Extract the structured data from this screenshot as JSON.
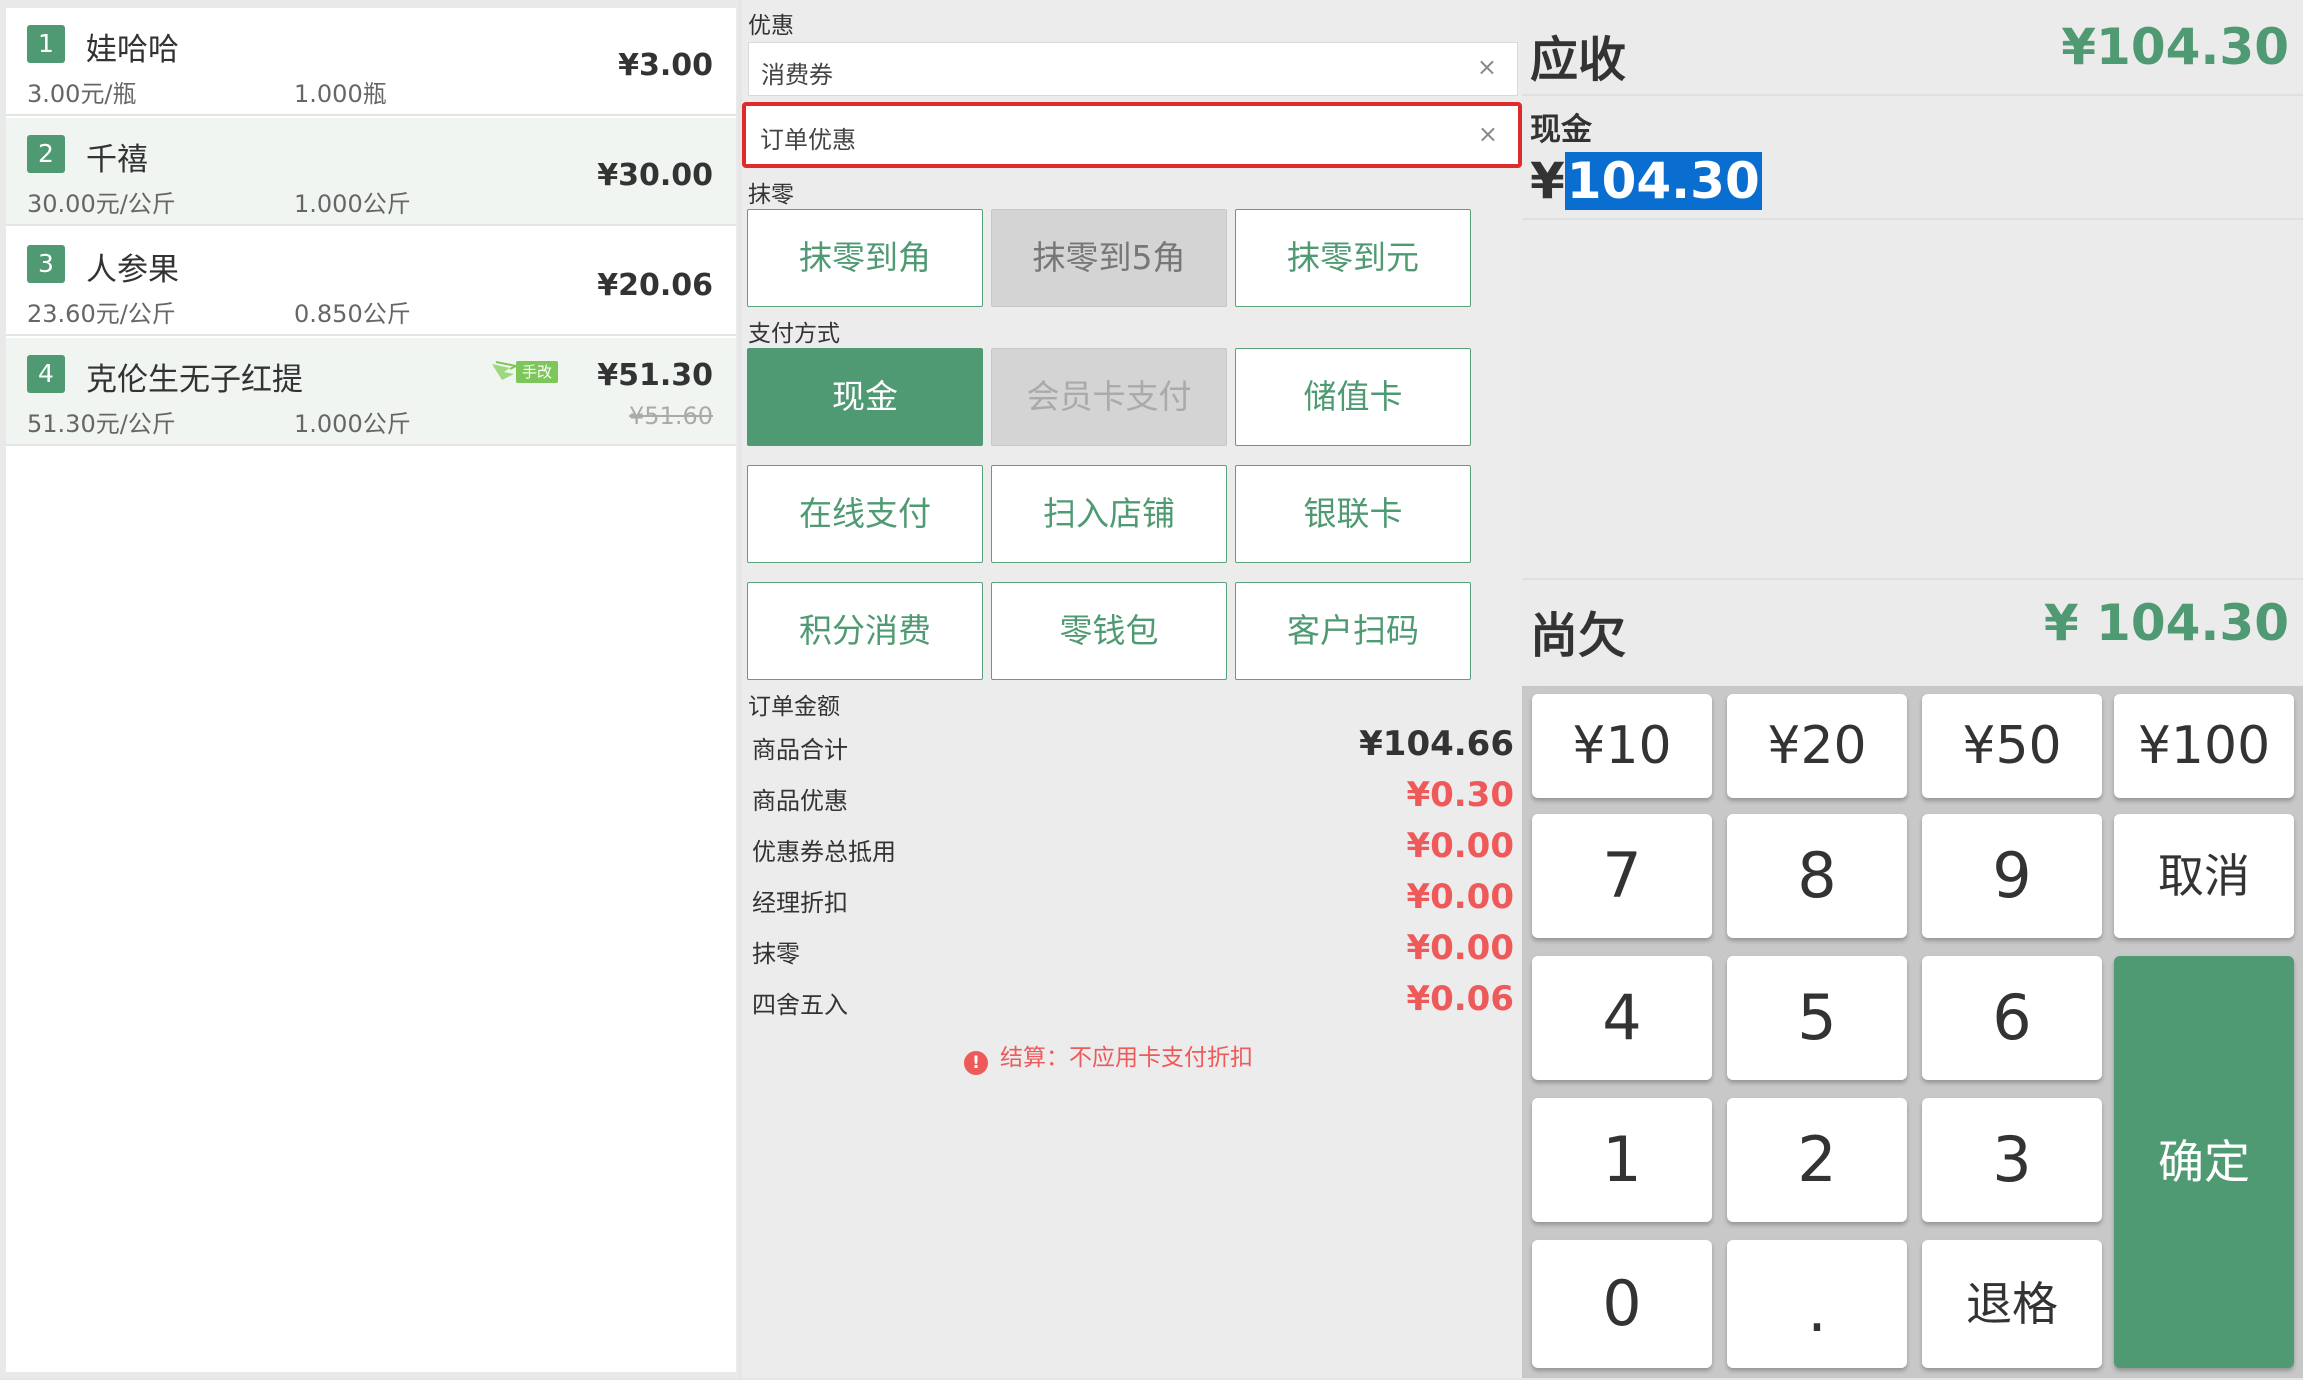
{
  "cart": {
    "items": [
      {
        "index": "1",
        "name": "娃哈哈",
        "unit_price": "3.00元/瓶",
        "quantity": "1.000瓶",
        "total": "¥3.00"
      },
      {
        "index": "2",
        "name": "千禧",
        "unit_price": "30.00元/公斤",
        "quantity": "1.000公斤",
        "total": "¥30.00"
      },
      {
        "index": "3",
        "name": "人参果",
        "unit_price": "23.60元/公斤",
        "quantity": "0.850公斤",
        "total": "¥20.06"
      },
      {
        "index": "4",
        "name": "克伦生无子红提",
        "unit_price": "51.30元/公斤",
        "quantity": "1.000公斤",
        "total": "¥51.30",
        "original_total": "¥51.60",
        "badge": "手改"
      }
    ]
  },
  "discount": {
    "section_label": "优惠",
    "coupon_placeholder": "消费券",
    "order_discount_placeholder": "订单优惠",
    "clear_glyph": "×"
  },
  "rounding": {
    "section_label": "抹零",
    "buttons": [
      "抹零到角",
      "抹零到5角",
      "抹零到元"
    ]
  },
  "payment": {
    "section_label": "支付方式",
    "methods": [
      "现金",
      "会员卡支付",
      "储值卡",
      "在线支付",
      "扫入店铺",
      "银联卡",
      "积分消费",
      "零钱包",
      "客户扫码"
    ],
    "selected": "现金"
  },
  "order_amount": {
    "section_label": "订单金额",
    "rows": [
      {
        "label": "商品合计",
        "value": "¥104.66"
      },
      {
        "label": "商品优惠",
        "value": "¥0.30"
      },
      {
        "label": "优惠券总抵用",
        "value": "¥0.00"
      },
      {
        "label": "经理折扣",
        "value": "¥0.00"
      },
      {
        "label": "抹零",
        "value": "¥0.00"
      },
      {
        "label": "四舍五入",
        "value": "¥0.06"
      }
    ],
    "notice_icon": "!",
    "notice": "结算：不应用卡支付折扣"
  },
  "checkout": {
    "receivable_label": "应收",
    "receivable_amount": "¥104.30",
    "cash_label": "现金",
    "cash_symbol": "¥",
    "cash_value": "104.30",
    "owed_label": "尚欠",
    "owed_amount": "¥ 104.30"
  },
  "keypad": {
    "quick": [
      "¥10",
      "¥20",
      "¥50",
      "¥100"
    ],
    "row1": [
      "7",
      "8",
      "9"
    ],
    "row2": [
      "4",
      "5",
      "6"
    ],
    "row3": [
      "1",
      "2",
      "3"
    ],
    "zero": "0",
    "dot": ".",
    "backspace": "退格",
    "cancel": "取消",
    "confirm": "确定"
  },
  "colors": {
    "brand_green": "#4f9a72",
    "alert_red": "#ee5a5a",
    "highlight_border": "#e02b2b",
    "selection_blue": "#0a6ed1"
  }
}
